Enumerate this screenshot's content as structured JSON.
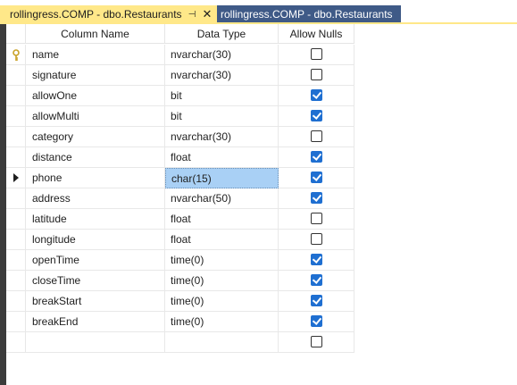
{
  "tabs": [
    {
      "label": "rollingress.COMP - dbo.Restaurants",
      "active": true
    },
    {
      "label": "rollingress.COMP - dbo.Restaurants",
      "active": false
    }
  ],
  "tab_pin_glyph": "⊣",
  "tab_close_glyph": "✕",
  "grid": {
    "headers": {
      "name": "Column Name",
      "type": "Data Type",
      "nulls": "Allow Nulls"
    },
    "rows": [
      {
        "name": "name",
        "type": "nvarchar(30)",
        "allow_nulls": false,
        "primary_key": true,
        "current": false
      },
      {
        "name": "signature",
        "type": "nvarchar(30)",
        "allow_nulls": false,
        "primary_key": false,
        "current": false
      },
      {
        "name": "allowOne",
        "type": "bit",
        "allow_nulls": true,
        "primary_key": false,
        "current": false
      },
      {
        "name": "allowMulti",
        "type": "bit",
        "allow_nulls": true,
        "primary_key": false,
        "current": false
      },
      {
        "name": "category",
        "type": "nvarchar(30)",
        "allow_nulls": false,
        "primary_key": false,
        "current": false
      },
      {
        "name": "distance",
        "type": "float",
        "allow_nulls": true,
        "primary_key": false,
        "current": false
      },
      {
        "name": "phone",
        "type": "char(15)",
        "allow_nulls": true,
        "primary_key": false,
        "current": true
      },
      {
        "name": "address",
        "type": "nvarchar(50)",
        "allow_nulls": true,
        "primary_key": false,
        "current": false
      },
      {
        "name": "latitude",
        "type": "float",
        "allow_nulls": false,
        "primary_key": false,
        "current": false
      },
      {
        "name": "longitude",
        "type": "float",
        "allow_nulls": false,
        "primary_key": false,
        "current": false
      },
      {
        "name": "openTime",
        "type": "time(0)",
        "allow_nulls": true,
        "primary_key": false,
        "current": false
      },
      {
        "name": "closeTime",
        "type": "time(0)",
        "allow_nulls": true,
        "primary_key": false,
        "current": false
      },
      {
        "name": "breakStart",
        "type": "time(0)",
        "allow_nulls": true,
        "primary_key": false,
        "current": false
      },
      {
        "name": "breakEnd",
        "type": "time(0)",
        "allow_nulls": true,
        "primary_key": false,
        "current": false
      },
      {
        "name": "",
        "type": "",
        "allow_nulls": false,
        "primary_key": false,
        "current": false
      }
    ]
  },
  "colors": {
    "active_tab": "#ffe889",
    "inactive_tab": "#3f5a87",
    "selection": "#a9d0f5",
    "checkbox_checked": "#1f6fd1",
    "key_icon": "#c9a227"
  }
}
